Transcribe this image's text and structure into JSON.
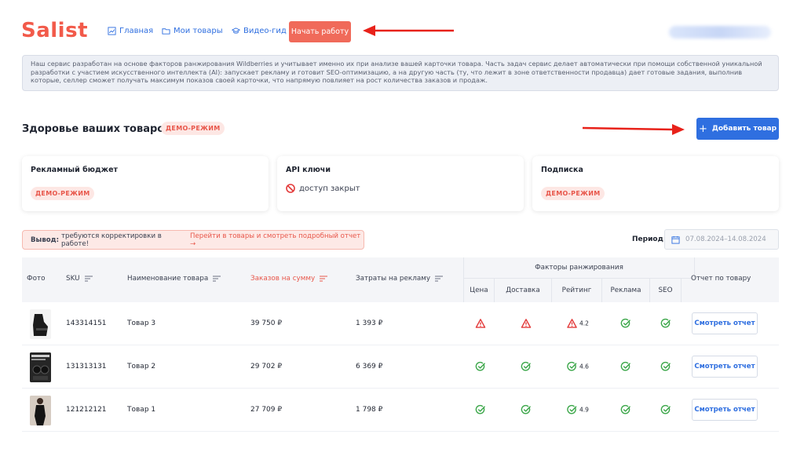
{
  "header": {
    "logo": "Salist",
    "nav": [
      {
        "label": "Главная",
        "icon": "chart-icon"
      },
      {
        "label": "Мои товары",
        "icon": "folder-icon"
      },
      {
        "label": "Видео-гид",
        "icon": "graduation-cap-icon"
      }
    ],
    "start_button": "Начать работу"
  },
  "info_text": "Наш сервис разработан на основе факторов ранжирования Wildberries и учитывает именно их при анализе вашей карточки товара. Часть задач сервис делает автоматически при помощи собственной уникальной разработки с участием искусственного интеллекта (AI): запускает рекламу и готовит SEO-оптимизацию, а на другую часть (ту, что лежит в зоне ответственности продавца) дает готовые задания, выполнив которые, селлер сможет получать максимум показов своей карточки, что напрямую повлияет на рост количества заказов и продаж.",
  "section": {
    "title": "Здоровье ваших товаров",
    "demo_tag": "ДЕМО-РЕЖИМ",
    "add_button": "Добавить товар"
  },
  "cards": [
    {
      "title": "Рекламный бюджет",
      "value": "ДЕМО-РЕЖИМ"
    },
    {
      "title": "API ключи",
      "value": "доступ закрыт"
    },
    {
      "title": "Подписка",
      "value": "ДЕМО-РЕЖИМ"
    }
  ],
  "conclusion": {
    "label": "Вывод:",
    "text": "требуются корректировки в работе!",
    "link": "Перейти в товары и смотреть подробный отчет →"
  },
  "period": {
    "label": "Период",
    "value": "07.08.2024–14.08.2024"
  },
  "table": {
    "headers": {
      "photo": "Фото",
      "sku": "SKU",
      "name": "Наименование товара",
      "orders": "Заказов на сумму",
      "ads": "Затраты на рекламу",
      "factors": "Факторы ранжирования",
      "report": "Отчет по товару"
    },
    "factor_headers": [
      "Цена",
      "Доставка",
      "Рейтинг",
      "Реклама",
      "SEO"
    ],
    "rows": [
      {
        "sku": "143314151",
        "name": "Товар 3",
        "orders": "39 750 ₽",
        "ads": "1 393 ₽",
        "price": "warning",
        "delivery": "warning",
        "rating_status": "warning",
        "rating": "4.2",
        "ads_status": "ok",
        "seo": "ok",
        "report": "Смотреть отчет"
      },
      {
        "sku": "131313131",
        "name": "Товар 2",
        "orders": "29 702 ₽",
        "ads": "6 369 ₽",
        "price": "ok",
        "delivery": "ok",
        "rating_status": "ok",
        "rating": "4.6",
        "ads_status": "ok",
        "seo": "ok",
        "report": "Смотреть отчет"
      },
      {
        "sku": "121212121",
        "name": "Товар 1",
        "orders": "27 709 ₽",
        "ads": "1 798 ₽",
        "price": "ok",
        "delivery": "ok",
        "rating_status": "ok",
        "rating": "4.9",
        "ads_status": "ok",
        "seo": "ok",
        "report": "Смотреть отчет"
      }
    ]
  },
  "colors": {
    "brand": "#f25a4a",
    "accent": "#2f6fe0",
    "ok": "#3aa648",
    "warning": "#e33b3b"
  }
}
